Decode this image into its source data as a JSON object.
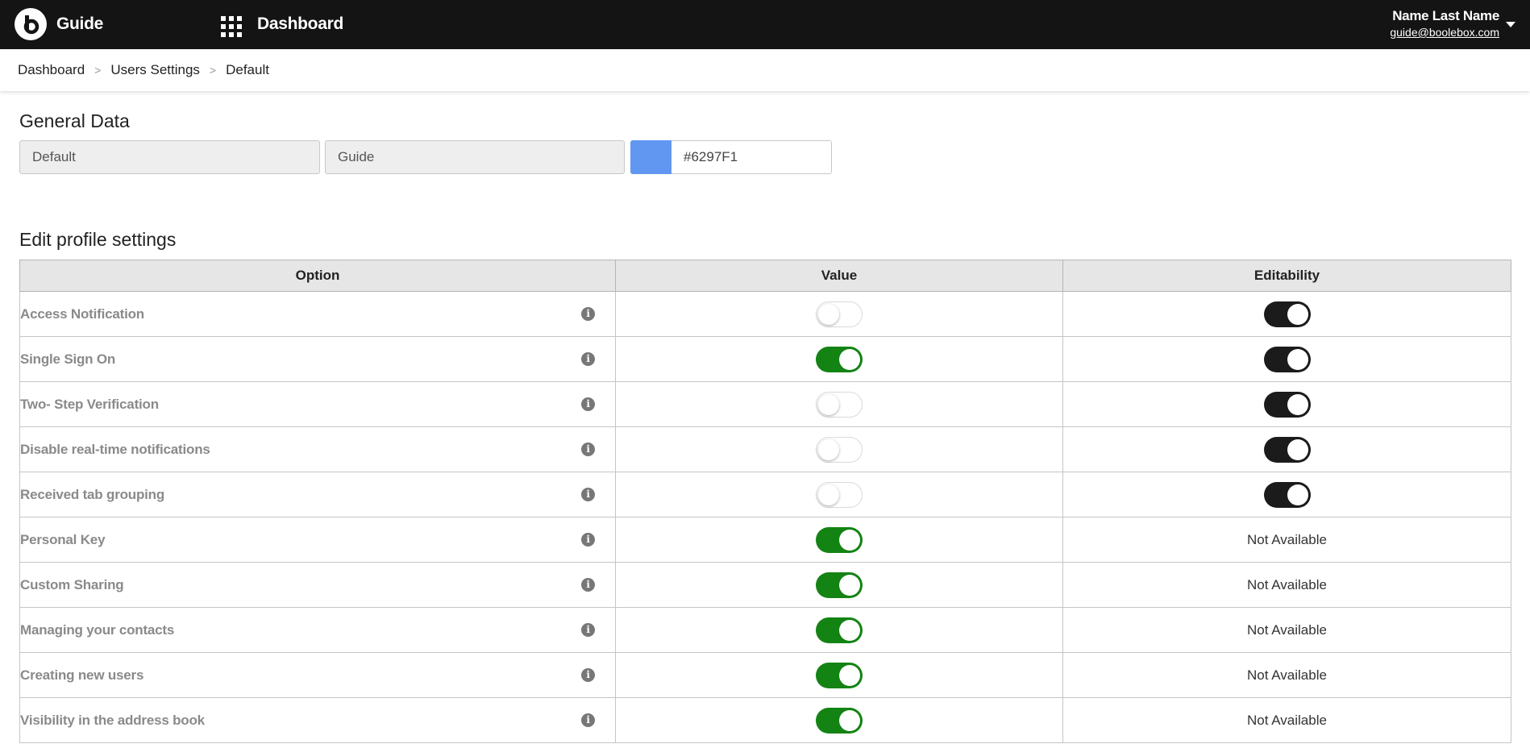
{
  "app": {
    "name": "Guide",
    "section": "Dashboard"
  },
  "user": {
    "name": "Name Last Name",
    "email": "guide@boolebox.com"
  },
  "breadcrumb": [
    "Dashboard",
    "Users Settings",
    "Default"
  ],
  "general": {
    "title": "General Data",
    "profile_name": "Default",
    "profile_desc": "Guide",
    "color_value": "#6297F1",
    "color_hex": "#6297F1"
  },
  "settings": {
    "title": "Edit profile settings",
    "columns": [
      "Option",
      "Value",
      "Editability"
    ],
    "rows": [
      {
        "option": "Access Notification",
        "value": "off",
        "editability": "on"
      },
      {
        "option": "Single Sign On",
        "value": "on",
        "editability": "on"
      },
      {
        "option": "Two- Step Verification",
        "value": "off",
        "editability": "on"
      },
      {
        "option": "Disable real-time notifications",
        "value": "off",
        "editability": "on"
      },
      {
        "option": "Received tab grouping",
        "value": "off",
        "editability": "on"
      },
      {
        "option": "Personal Key",
        "value": "on",
        "editability": "Not Available"
      },
      {
        "option": "Custom Sharing",
        "value": "on",
        "editability": "Not Available"
      },
      {
        "option": "Managing your contacts",
        "value": "on",
        "editability": "Not Available"
      },
      {
        "option": "Creating new users",
        "value": "on",
        "editability": "Not Available"
      },
      {
        "option": "Visibility in the address book",
        "value": "on",
        "editability": "Not Available"
      }
    ]
  },
  "colors": {
    "topbar": "#141414",
    "toggle_value_on": "#138313",
    "toggle_edit_on": "#1b1b1b"
  }
}
